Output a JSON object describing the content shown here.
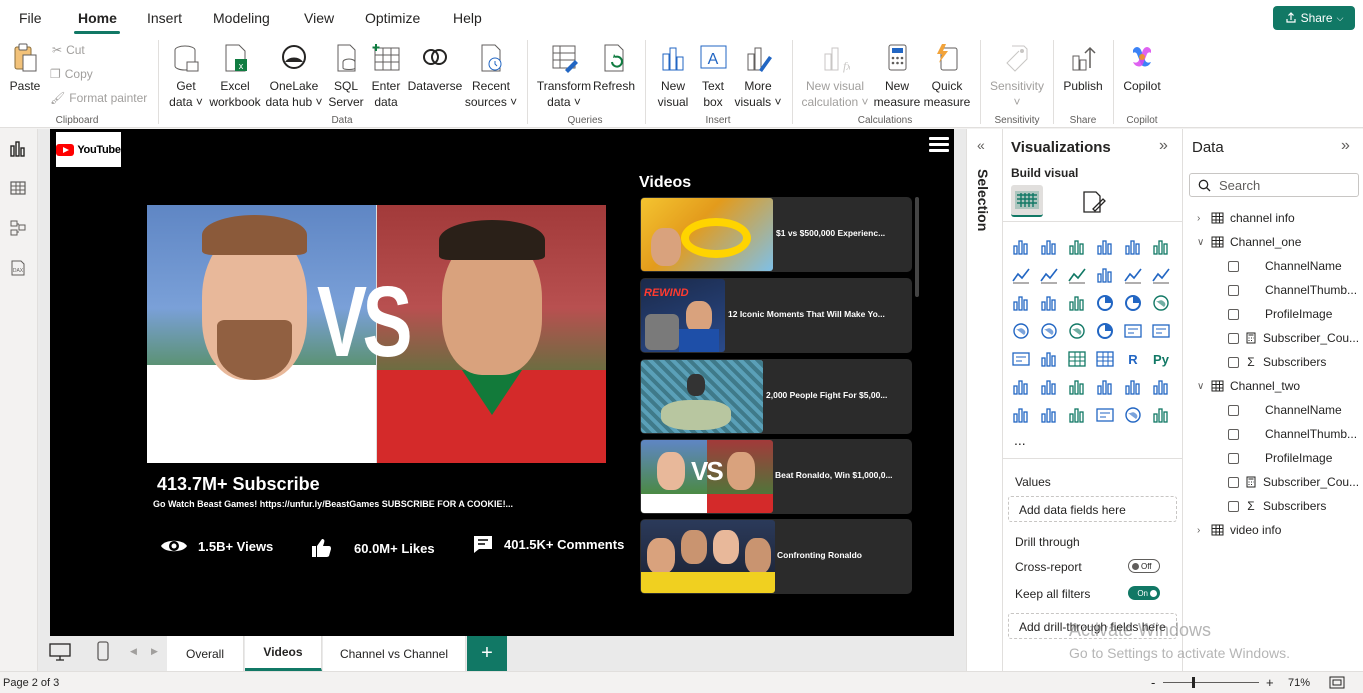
{
  "menu": {
    "items": [
      "File",
      "Home",
      "Insert",
      "Modeling",
      "View",
      "Optimize",
      "Help"
    ],
    "share_label": "Share"
  },
  "ribbon": {
    "clipboard": {
      "paste": "Paste",
      "cut": "Cut",
      "copy": "Copy",
      "format_painter": "Format painter",
      "group": "Clipboard"
    },
    "data": {
      "get_data": [
        "Get",
        "data"
      ],
      "excel": [
        "Excel",
        "workbook"
      ],
      "onelake": [
        "OneLake",
        "data hub"
      ],
      "sql": [
        "SQL",
        "Server"
      ],
      "enter": [
        "Enter",
        "data"
      ],
      "dataverse": "Dataverse",
      "recent": [
        "Recent",
        "sources"
      ],
      "group": "Data"
    },
    "queries": {
      "transform": [
        "Transform",
        "data"
      ],
      "refresh": "Refresh",
      "group": "Queries"
    },
    "insert": {
      "new_visual": [
        "New",
        "visual"
      ],
      "text_box": [
        "Text",
        "box"
      ],
      "more_visuals": [
        "More",
        "visuals"
      ],
      "group": "Insert"
    },
    "calculations": {
      "new_visual_calc": [
        "New visual",
        "calculation"
      ],
      "new_measure": [
        "New",
        "measure"
      ],
      "quick_measure": [
        "Quick",
        "measure"
      ],
      "group": "Calculations"
    },
    "sensitivity": {
      "label": "Sensitivity",
      "group": "Sensitivity"
    },
    "share": {
      "publish": "Publish",
      "group": "Share"
    },
    "copilot": {
      "label": "Copilot",
      "group": "Copilot"
    }
  },
  "report": {
    "logo_text": "YouTube",
    "vs_text": "VS",
    "subscribe_title": "413.7M+ Subscribe",
    "description": "Go Watch Beast Games! https://unfur.ly/BeastGames SUBSCRIBE FOR A COOKIE!...",
    "stats": {
      "views": "1.5B+ Views",
      "likes": "60.0M+ Likes",
      "comments": "401.5K+ Comments"
    },
    "videos_title": "Videos",
    "videos": [
      {
        "title": "$1 vs $500,000 Experienc..."
      },
      {
        "title": "12 Iconic Moments That Will Make Yo...",
        "thumb_text": "REWIND"
      },
      {
        "title": "2,000 People Fight For $5,00..."
      },
      {
        "title": "Beat Ronaldo, Win $1,000,0...",
        "thumb_text": "VS"
      },
      {
        "title": "Confronting Ronaldo"
      }
    ]
  },
  "pages": {
    "tabs": [
      "Overall",
      "Videos",
      "Channel vs Channel"
    ],
    "active": "Videos",
    "add_label": "+"
  },
  "status": {
    "page_indicator": "Page 2 of 3",
    "zoom": "71%",
    "zoom_minus": "-",
    "zoom_plus": "+"
  },
  "selection_pane": {
    "label": "Selection"
  },
  "visualizations": {
    "title": "Visualizations",
    "build_visual": "Build visual",
    "more": "...",
    "values_label": "Values",
    "values_placeholder": "Add data fields here",
    "drill_through": "Drill through",
    "cross_report": "Cross-report",
    "cross_report_state": "Off",
    "keep_filters": "Keep all filters",
    "keep_filters_state": "On",
    "drill_placeholder": "Add drill-through fields here"
  },
  "data_pane": {
    "title": "Data",
    "search_placeholder": "Search",
    "tables": [
      {
        "name": "channel info",
        "expanded": false,
        "fields": []
      },
      {
        "name": "Channel_one",
        "expanded": true,
        "fields": [
          {
            "name": "ChannelName",
            "kind": "text"
          },
          {
            "name": "ChannelThumb...",
            "kind": "text"
          },
          {
            "name": "ProfileImage",
            "kind": "text"
          },
          {
            "name": "Subscriber_Cou...",
            "kind": "measure"
          },
          {
            "name": "Subscribers",
            "kind": "sum"
          }
        ]
      },
      {
        "name": "Channel_two",
        "expanded": true,
        "fields": [
          {
            "name": "ChannelName",
            "kind": "text"
          },
          {
            "name": "ChannelThumb...",
            "kind": "text"
          },
          {
            "name": "ProfileImage",
            "kind": "text"
          },
          {
            "name": "Subscriber_Cou...",
            "kind": "measure"
          },
          {
            "name": "Subscribers",
            "kind": "sum"
          }
        ]
      },
      {
        "name": "video info",
        "expanded": false,
        "fields": []
      }
    ]
  },
  "watermark": {
    "line1": "Activate Windows",
    "line2": "Go to Settings to activate Windows."
  },
  "colors": {
    "accent": "#117865",
    "report_bg": "#000000",
    "card_bg": "#2b2b2b"
  }
}
